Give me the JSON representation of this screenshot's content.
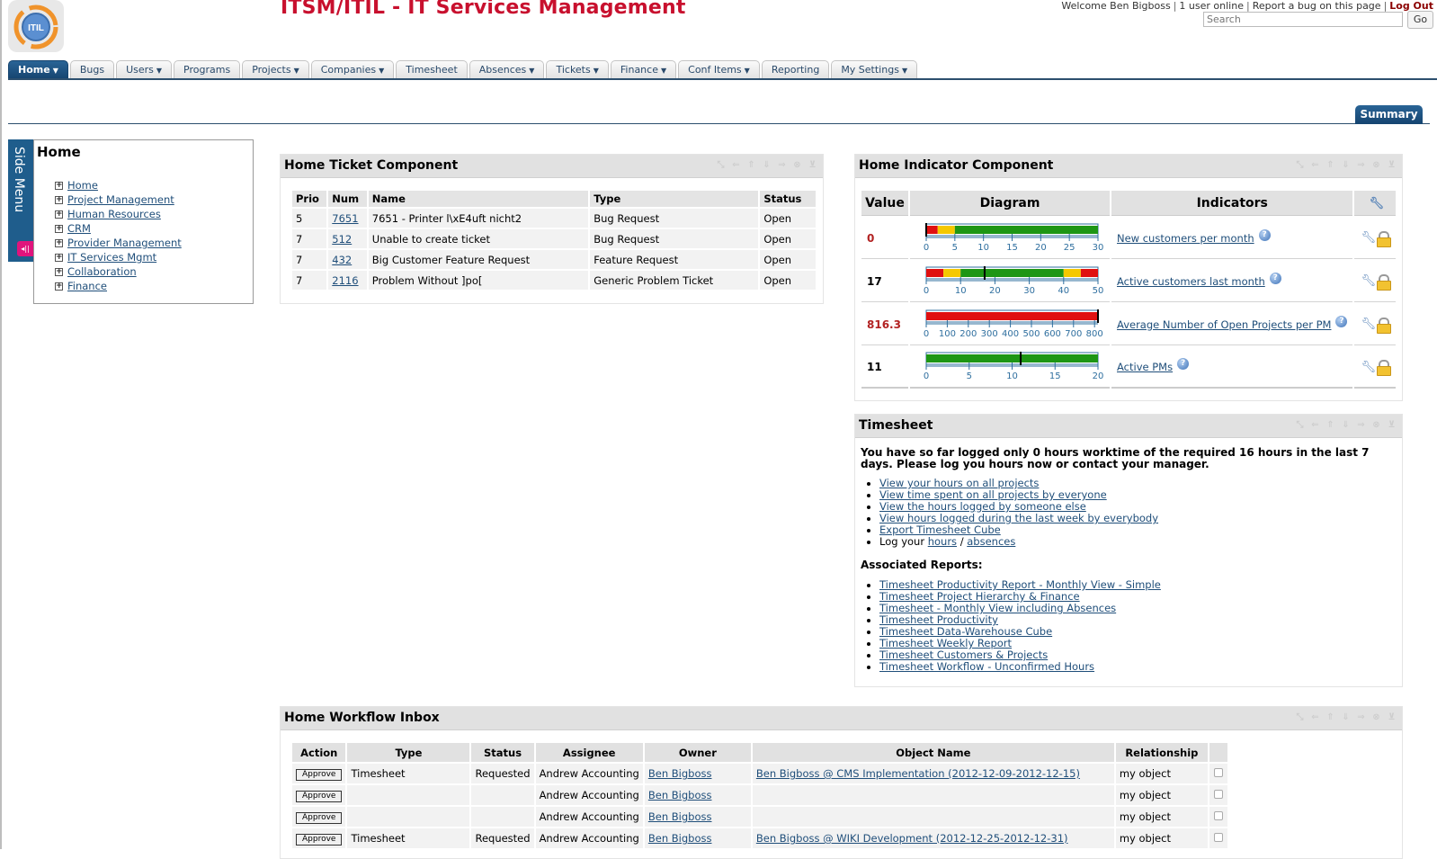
{
  "header": {
    "app_title": "ITSM/ITIL - IT Services Management",
    "logo_text": "ITIL",
    "welcome": "Welcome Ben Bigboss",
    "users_online": "1 user online",
    "report_bug": "Report a bug on this page",
    "logout": "Log Out",
    "search_placeholder": "Search",
    "go_label": "Go"
  },
  "nav": {
    "tabs": [
      {
        "label": "Home",
        "dropdown": true,
        "active": true
      },
      {
        "label": "Bugs",
        "dropdown": false
      },
      {
        "label": "Users",
        "dropdown": true
      },
      {
        "label": "Programs",
        "dropdown": false
      },
      {
        "label": "Projects",
        "dropdown": true
      },
      {
        "label": "Companies",
        "dropdown": true
      },
      {
        "label": "Timesheet",
        "dropdown": false
      },
      {
        "label": "Absences",
        "dropdown": true
      },
      {
        "label": "Tickets",
        "dropdown": true
      },
      {
        "label": "Finance",
        "dropdown": true
      },
      {
        "label": "Conf Items",
        "dropdown": true
      },
      {
        "label": "Reporting",
        "dropdown": false
      },
      {
        "label": "My Settings",
        "dropdown": true
      }
    ],
    "subtab": "Summary"
  },
  "side_menu": {
    "tab_label": "Side Menu",
    "title": "Home",
    "items": [
      "Home",
      "Project Management",
      "Human Resources",
      "CRM",
      "Provider Management",
      "IT Services Mgmt",
      "Collaboration",
      "Finance"
    ]
  },
  "tickets": {
    "title": "Home Ticket Component",
    "columns": [
      "Prio",
      "Num",
      "Name",
      "Type",
      "Status"
    ],
    "rows": [
      {
        "prio": "5",
        "num": "7651",
        "name": "7651 - Printer l\\xE4uft nicht2",
        "type": "Bug Request",
        "status": "Open"
      },
      {
        "prio": "7",
        "num": "512",
        "name": "Unable to create ticket",
        "type": "Bug Request",
        "status": "Open"
      },
      {
        "prio": "7",
        "num": "432",
        "name": "Big Customer Feature Request",
        "type": "Feature Request",
        "status": "Open"
      },
      {
        "prio": "7",
        "num": "2116",
        "name": "Problem Without ]po[",
        "type": "Generic Problem Ticket",
        "status": "Open"
      }
    ]
  },
  "indicators": {
    "title": "Home Indicator Component",
    "columns": [
      "Value",
      "Diagram",
      "Indicators"
    ],
    "rows": [
      {
        "value": "0",
        "value_color": "#b22222",
        "name": "New customers per month",
        "min": 0,
        "max": 30,
        "ticks": [
          0,
          5,
          10,
          15,
          20,
          25,
          30
        ],
        "marker": 0,
        "bands": [
          {
            "from": 0,
            "to": 2,
            "color": "#e01010"
          },
          {
            "from": 2,
            "to": 5,
            "color": "#f5c800"
          },
          {
            "from": 5,
            "to": 30,
            "color": "#1e9614"
          }
        ]
      },
      {
        "value": "17",
        "value_color": "#000000",
        "name": "Active customers last month",
        "min": 0,
        "max": 50,
        "ticks": [
          0,
          10,
          20,
          30,
          40,
          50
        ],
        "marker": 17,
        "bands": [
          {
            "from": 0,
            "to": 5,
            "color": "#e01010"
          },
          {
            "from": 5,
            "to": 10,
            "color": "#f5c800"
          },
          {
            "from": 10,
            "to": 40,
            "color": "#1e9614"
          },
          {
            "from": 40,
            "to": 45,
            "color": "#f5c800"
          },
          {
            "from": 45,
            "to": 50,
            "color": "#e01010"
          }
        ]
      },
      {
        "value": "816.3",
        "value_color": "#b22222",
        "name": "Average Number of Open Projects per PM",
        "min": 0,
        "max": 816.3,
        "ticks": [
          0,
          100,
          200,
          300,
          400,
          500,
          600,
          700,
          800
        ],
        "marker": 816.3,
        "bands": [
          {
            "from": 0,
            "to": 816.3,
            "color": "#e01010"
          }
        ]
      },
      {
        "value": "11",
        "value_color": "#000000",
        "name": "Active PMs",
        "min": 0,
        "max": 20,
        "ticks": [
          0,
          5,
          10,
          15,
          20
        ],
        "marker": 11,
        "bands": [
          {
            "from": 0,
            "to": 20,
            "color": "#1e9614"
          }
        ]
      }
    ]
  },
  "timesheet": {
    "title": "Timesheet",
    "message": "You have so far logged only 0 hours worktime of the required 16 hours in the last 7 days. Please log you hours now or contact your manager.",
    "links": [
      "View your hours on all projects",
      "View time spent on all projects by everyone",
      "View the hours logged by someone else",
      "View hours logged during the last week by everybody",
      "Export Timesheet Cube"
    ],
    "log_prefix": "Log your",
    "log_hours": "hours",
    "log_sep": "/",
    "log_absences": "absences",
    "assoc_title": "Associated Reports:",
    "reports": [
      "Timesheet Productivity Report - Monthly View - Simple",
      "Timesheet Project Hierarchy & Finance",
      "Timesheet - Monthly View including Absences",
      "Timesheet Productivity",
      "Timesheet Data-Warehouse Cube",
      "Timesheet Weekly Report",
      "Timesheet Customers & Projects",
      "Timesheet Workflow - Unconfirmed Hours"
    ]
  },
  "workflow": {
    "title": "Home Workflow Inbox",
    "columns": [
      "Action",
      "Type",
      "Status",
      "Assignee",
      "Owner",
      "Object Name",
      "Relationship",
      ""
    ],
    "rows": [
      {
        "action": "Approve",
        "type": "Timesheet",
        "status": "Requested",
        "assignee": "Andrew Accounting",
        "owner": "Ben Bigboss",
        "object": "Ben Bigboss @ CMS Implementation (2012-12-09-2012-12-15)",
        "relationship": "my object",
        "checked": false
      },
      {
        "action": "Approve",
        "type": "",
        "status": "",
        "assignee": "Andrew Accounting",
        "owner": "Ben Bigboss",
        "object": "",
        "relationship": "my object",
        "checked": false
      },
      {
        "action": "Approve",
        "type": "",
        "status": "",
        "assignee": "Andrew Accounting",
        "owner": "Ben Bigboss",
        "object": "",
        "relationship": "my object",
        "checked": false
      },
      {
        "action": "Approve",
        "type": "Timesheet",
        "status": "Requested",
        "assignee": "Andrew Accounting",
        "owner": "Ben Bigboss",
        "object": "Ben Bigboss @ WIKI Development (2012-12-25-2012-12-31)",
        "relationship": "my object",
        "checked": false
      }
    ]
  },
  "portlet_controls": [
    "resize-icon",
    "move-left-icon",
    "move-up-icon",
    "move-down-icon",
    "move-right-icon",
    "close-icon",
    "minimize-icon"
  ]
}
